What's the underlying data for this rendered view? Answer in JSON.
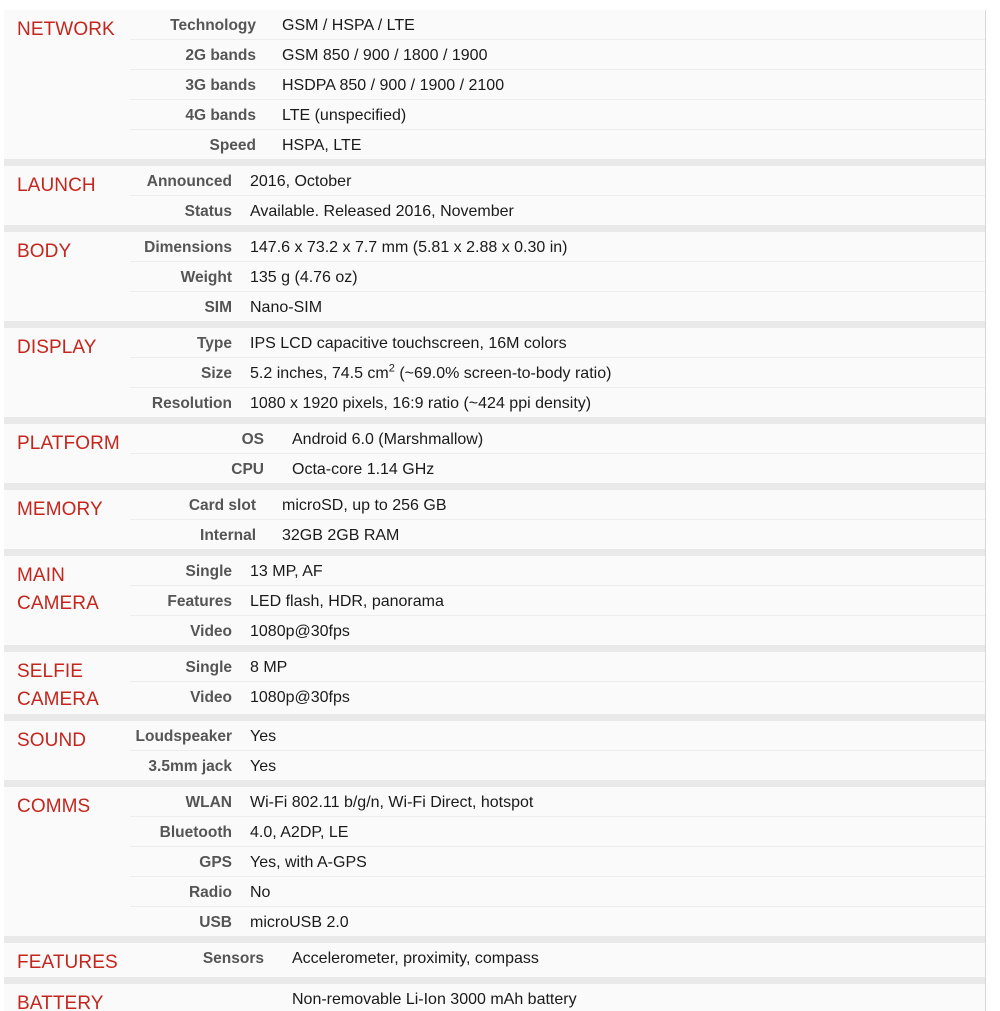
{
  "theme": {
    "header_color": "#c4261d",
    "label_color": "#555555",
    "value_color": "#1a1a1a",
    "row_background": "#fafafa",
    "section_gap_color": "#e9e9e9",
    "row_divider_color": "#ededed"
  },
  "sections": [
    {
      "title": "NETWORK",
      "width": "med",
      "rows": [
        {
          "label": "Technology",
          "value": "GSM / HSPA / LTE"
        },
        {
          "label": "2G bands",
          "value": "GSM 850 / 900 / 1800 / 1900"
        },
        {
          "label": "3G bands",
          "value": "HSDPA 850 / 900 / 1900 / 2100"
        },
        {
          "label": "4G bands",
          "value": "LTE (unspecified)"
        },
        {
          "label": "Speed",
          "value": "HSPA, LTE"
        }
      ]
    },
    {
      "title": "LAUNCH",
      "width": "narrow",
      "rows": [
        {
          "label": "Announced",
          "value": "2016, October"
        },
        {
          "label": "Status",
          "value": "Available. Released 2016, November"
        }
      ]
    },
    {
      "title": "BODY",
      "width": "narrow",
      "rows": [
        {
          "label": "Dimensions",
          "value": "147.6 x 73.2 x 7.7 mm (5.81 x 2.88 x 0.30 in)"
        },
        {
          "label": "Weight",
          "value": "135 g (4.76 oz)"
        },
        {
          "label": "SIM",
          "value": "Nano-SIM"
        }
      ]
    },
    {
      "title": "DISPLAY",
      "width": "narrow",
      "rows": [
        {
          "label": "Type",
          "value": "IPS LCD capacitive touchscreen, 16M colors"
        },
        {
          "label": "Size",
          "value_prefix": "5.2 inches, 74.5 cm",
          "superscript": "2",
          "value_suffix": " (~69.0% screen-to-body ratio)"
        },
        {
          "label": "Resolution",
          "value": "1080 x 1920 pixels, 16:9 ratio (~424 ppi density)"
        }
      ]
    },
    {
      "title": "PLATFORM",
      "width": "wide",
      "rows": [
        {
          "label": "OS",
          "value": "Android 6.0 (Marshmallow)"
        },
        {
          "label": "CPU",
          "value": "Octa-core 1.14 GHz"
        }
      ]
    },
    {
      "title": "MEMORY",
      "width": "med",
      "rows": [
        {
          "label": "Card slot",
          "value": "microSD, up to 256 GB"
        },
        {
          "label": "Internal",
          "value": "32GB 2GB RAM"
        }
      ]
    },
    {
      "title": "MAIN CAMERA",
      "width": "narrow",
      "rows": [
        {
          "label": "Single",
          "value": "13 MP, AF"
        },
        {
          "label": "Features",
          "value": "LED flash, HDR, panorama"
        },
        {
          "label": "Video",
          "value": "1080p@30fps"
        }
      ]
    },
    {
      "title": "SELFIE CAMERA",
      "width": "narrow",
      "rows": [
        {
          "label": "Single",
          "value": "8 MP"
        },
        {
          "label": "Video",
          "value": "1080p@30fps"
        }
      ]
    },
    {
      "title": "SOUND",
      "width": "narrow",
      "rows": [
        {
          "label": "Loudspeaker",
          "value": "Yes"
        },
        {
          "label": "3.5mm jack",
          "value": "Yes"
        }
      ]
    },
    {
      "title": "COMMS",
      "width": "narrow",
      "rows": [
        {
          "label": "WLAN",
          "value": "Wi-Fi 802.11 b/g/n, Wi-Fi Direct, hotspot"
        },
        {
          "label": "Bluetooth",
          "value": "4.0, A2DP, LE"
        },
        {
          "label": "GPS",
          "value": "Yes, with A-GPS"
        },
        {
          "label": "Radio",
          "value": "No"
        },
        {
          "label": "USB",
          "value": "microUSB 2.0"
        }
      ]
    },
    {
      "title": "FEATURES",
      "width": "wide",
      "rows": [
        {
          "label": "Sensors",
          "value": "Accelerometer, proximity, compass"
        }
      ]
    },
    {
      "title": "BATTERY",
      "width": "wide",
      "rows": [
        {
          "label": "",
          "value": "Non-removable Li-Ion 3000 mAh battery"
        }
      ]
    }
  ]
}
